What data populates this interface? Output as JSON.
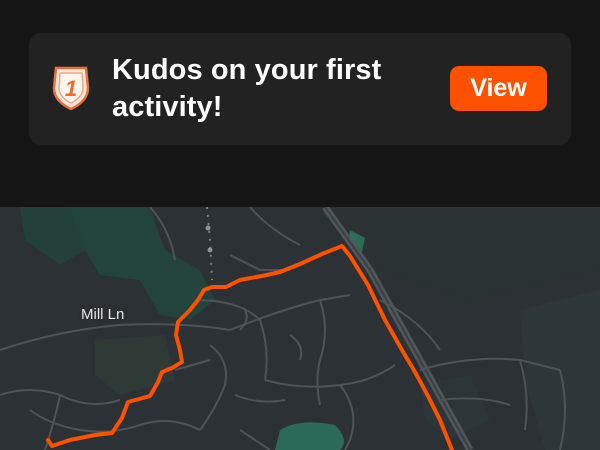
{
  "notification": {
    "message": "Kudos on your first activity!",
    "badge_number": "1",
    "badge_icon": "shield-badge-icon",
    "view_label": "View",
    "accent_color": "#fc5200"
  },
  "map": {
    "street_label": "Mill Ln",
    "route_color": "#fc5200",
    "background_color": "#2b3134"
  }
}
